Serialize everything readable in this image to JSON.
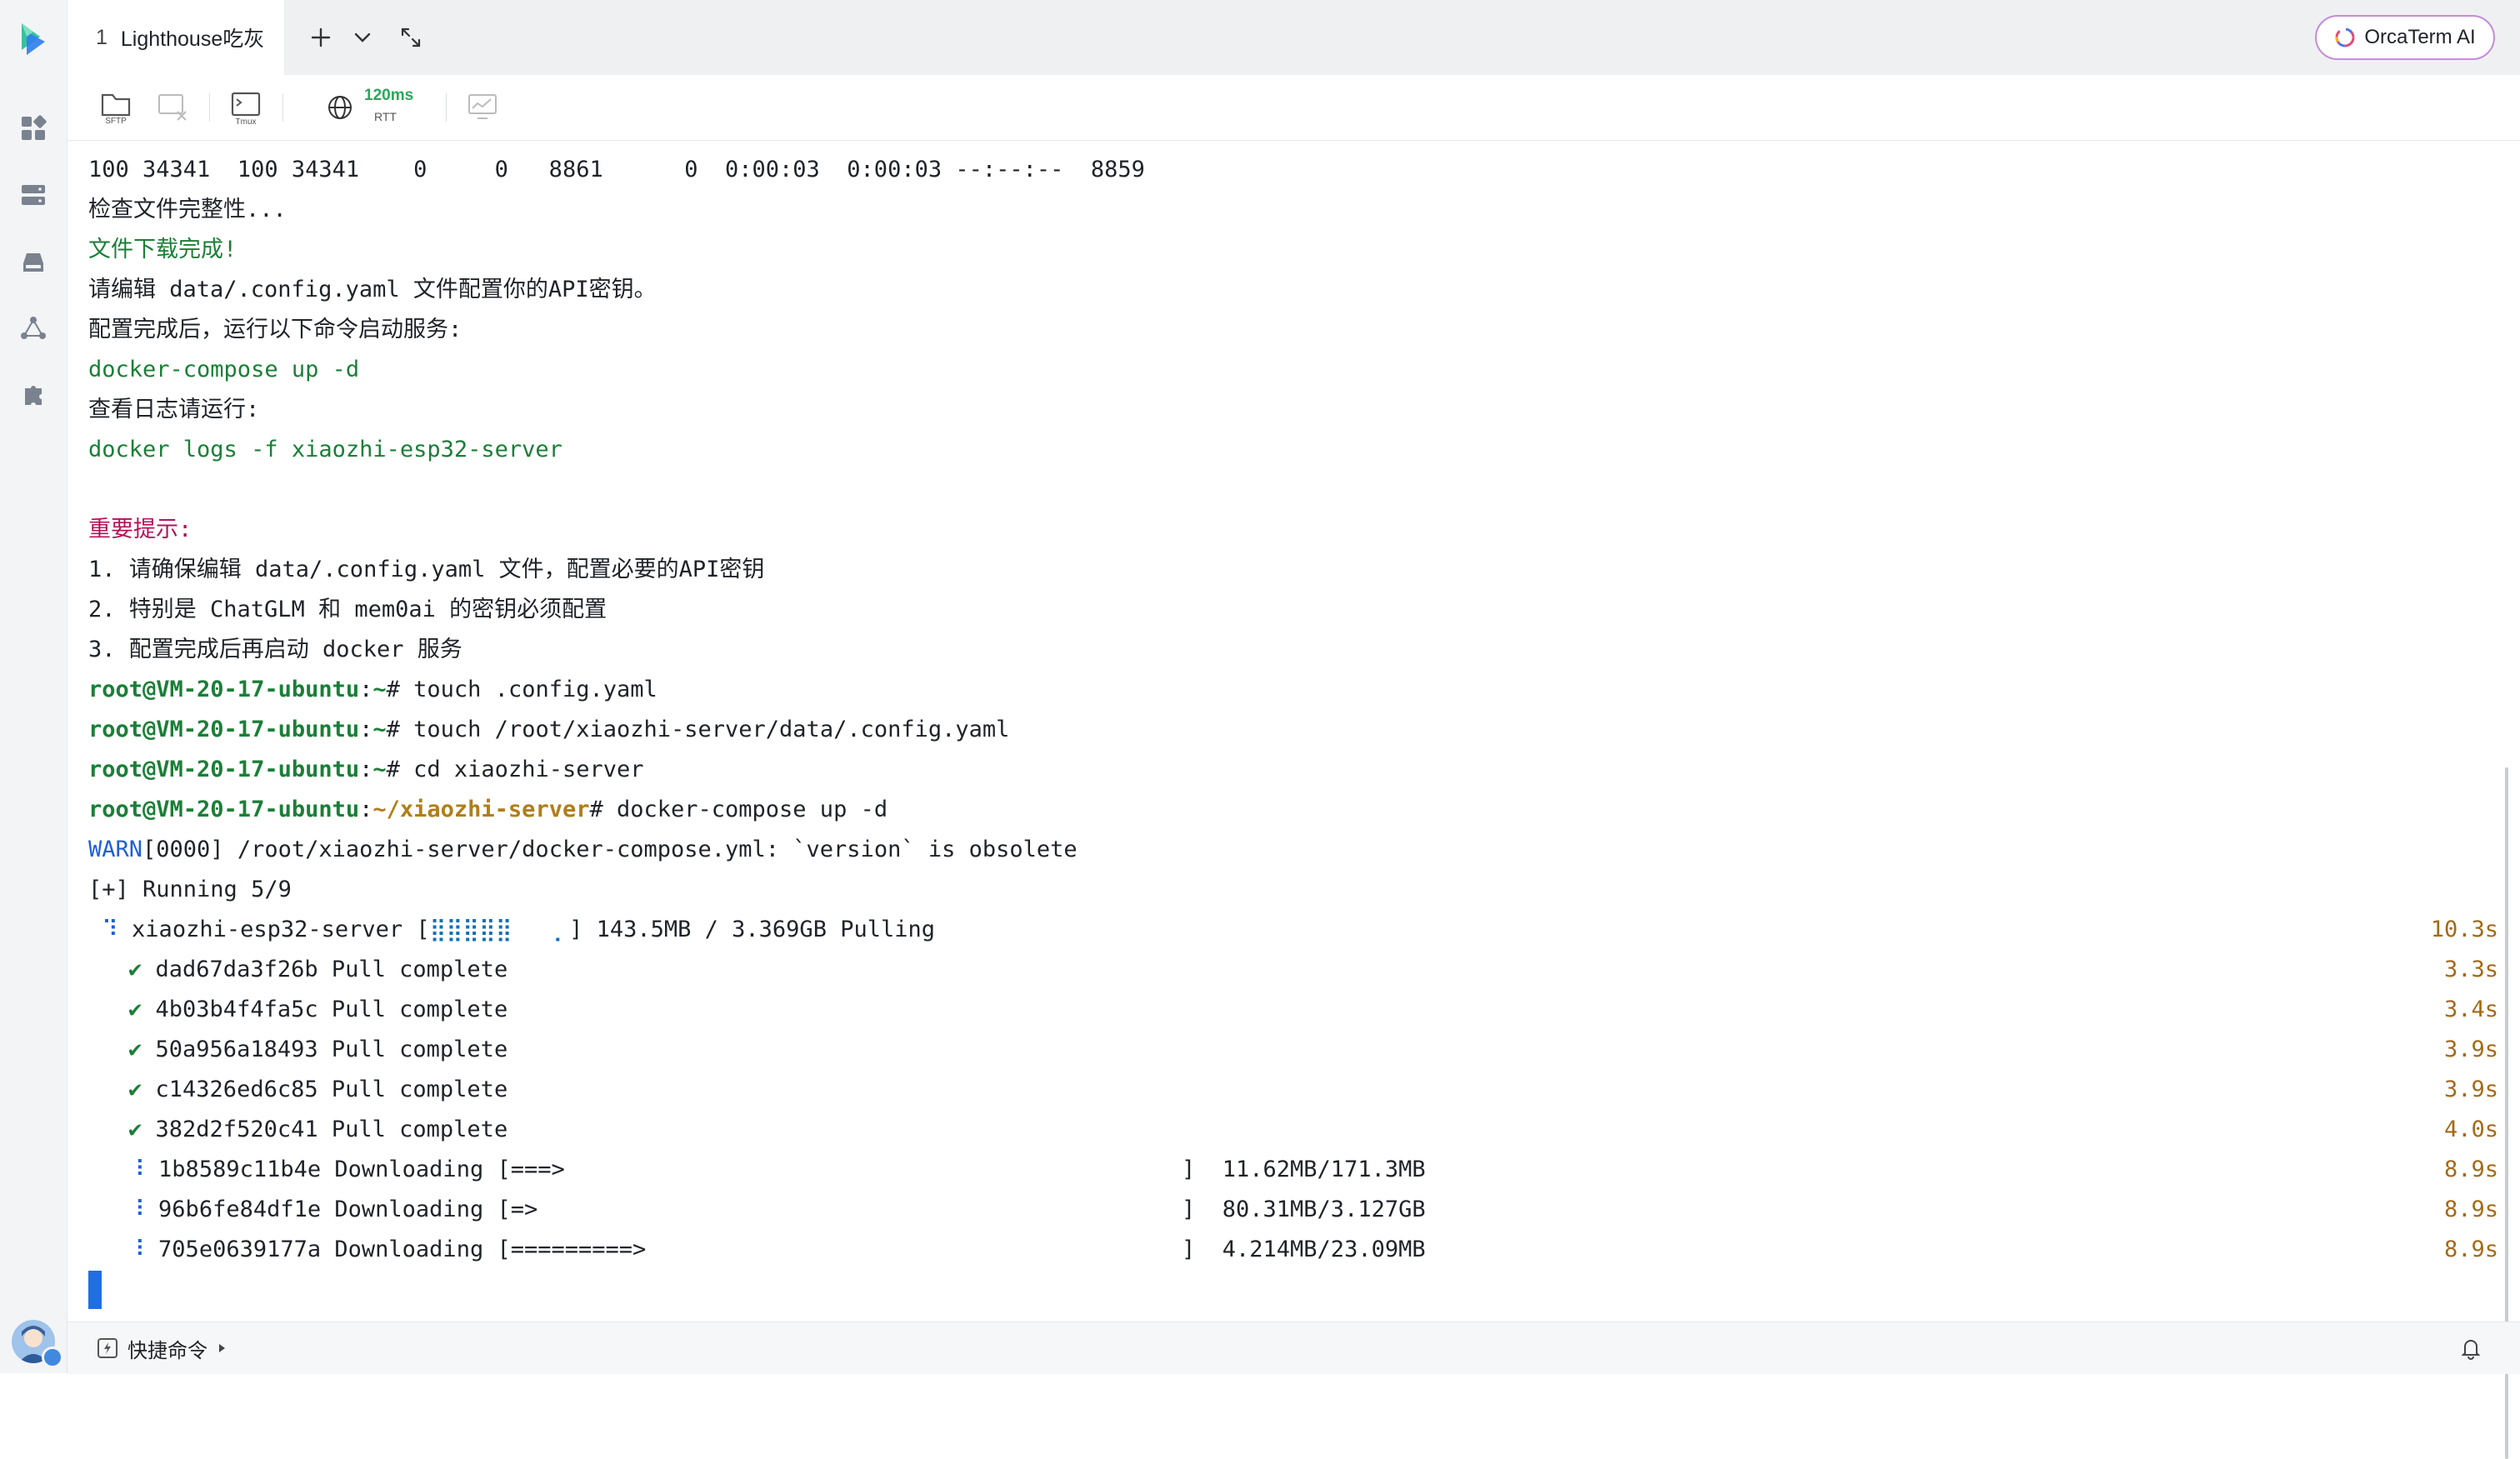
{
  "tabbar": {
    "tab_number": "1",
    "tab_title": "Lighthouse吃灰",
    "ai_button_label": "OrcaTerm AI"
  },
  "toolbar": {
    "sftp_label": "SFTP",
    "tmux_label": "Tmux",
    "latency": "120ms",
    "latency_label": "RTT"
  },
  "terminal": {
    "lines": [
      "100 34341  100 34341    0     0   8861      0  0:00:03  0:00:03 --:--:--  8859",
      "检查文件完整性...",
      "文件下载完成!",
      "请编辑 data/.config.yaml 文件配置你的API密钥。",
      "配置完成后，运行以下命令启动服务:",
      "docker-compose up -d",
      "查看日志请运行:",
      "docker logs -f xiaozhi-esp32-server",
      "重要提示:",
      "1. 请确保编辑 data/.config.yaml 文件，配置必要的API密钥",
      "2. 特别是 ChatGLM 和 mem0ai 的密钥必须配置",
      "3. 配置完成后再启动 docker 服务"
    ],
    "prompt_user": "root@VM-20-17-ubuntu",
    "home_path": "~",
    "server_path": "~/xiaozhi-server",
    "commands": [
      "# touch .config.yaml",
      "# touch /root/xiaozhi-server/data/.config.yaml",
      "# cd xiaozhi-server",
      "# docker-compose up -d"
    ],
    "warn_tag": "WARN",
    "warn_text": "[0000] /root/xiaozhi-server/docker-compose.yml: `version` is obsolete",
    "running": "[+] Running 5/9",
    "main_pull": {
      "icon": "⠹",
      "text": "xiaozhi-esp32-server [",
      "bar": "⣿⣿⣿⣿⣿   ⡀",
      "suffix": "] 143.5MB / 3.369GB Pulling",
      "time": "10.3s"
    },
    "layers": [
      {
        "icon": "✔",
        "id": "dad67da3f26b",
        "status": "Pull complete",
        "time": "3.3s"
      },
      {
        "icon": "✔",
        "id": "4b03b4f4fa5c",
        "status": "Pull complete",
        "time": "3.4s"
      },
      {
        "icon": "✔",
        "id": "50a956a18493",
        "status": "Pull complete",
        "time": "3.9s"
      },
      {
        "icon": "✔",
        "id": "c14326ed6c85",
        "status": "Pull complete",
        "time": "3.9s"
      },
      {
        "icon": "✔",
        "id": "382d2f520c41",
        "status": "Pull complete",
        "time": "4.0s"
      },
      {
        "icon": "⠸",
        "id": "1b8589c11b4e",
        "status": "Downloading [===>",
        "size": "]  11.62MB/171.3MB",
        "time": "8.9s"
      },
      {
        "icon": "⠸",
        "id": "96b6fe84df1e",
        "status": "Downloading [=>",
        "size": "]  80.31MB/3.127GB",
        "time": "8.9s"
      },
      {
        "icon": "⠸",
        "id": "705e0639177a",
        "status": "Downloading [=========>",
        "size": "]  4.214MB/23.09MB",
        "time": "8.9s"
      }
    ]
  },
  "statusbar": {
    "quick_commands": "快捷命令"
  },
  "colors": {
    "terminal_green": "#1a7f37",
    "terminal_red": "#b4135a",
    "terminal_path": "#b07e1a",
    "warn_blue": "#1f5fd6",
    "time_orange": "#a46a14",
    "cursor_blue": "#1f6fe0"
  }
}
